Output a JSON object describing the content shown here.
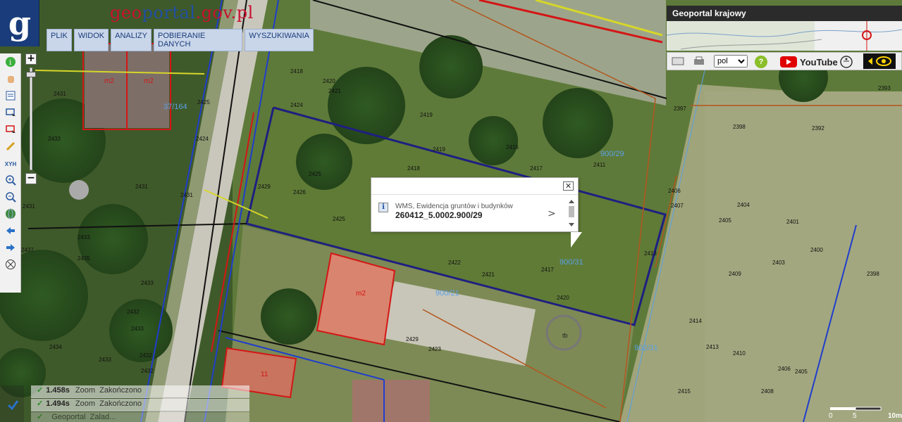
{
  "app": {
    "brand_part1": "geo",
    "brand_part2": "portal",
    "brand_part3": ".gov.pl",
    "logo_letter": "g"
  },
  "menu": [
    "PLIK",
    "WIDOK",
    "ANALIZY",
    "POBIERANIE DANYCH",
    "WYSZUKIWANIA"
  ],
  "toolbar": {
    "zoom_in_label": "+",
    "zoom_out_label": "−",
    "xyh_label": "XYH",
    "icons": [
      "info-icon",
      "hand-icon",
      "layers-icon",
      "select-icon",
      "select-red-icon",
      "pencil-icon",
      "xyh-icon",
      "zoom-in-icon",
      "zoom-out-icon",
      "globe-icon",
      "back-arrow-icon",
      "forward-arrow-icon",
      "compass-icon"
    ]
  },
  "overview": {
    "title": "Geoportal krajowy"
  },
  "topbar": {
    "language": "pol",
    "youtube_label": "YouTube",
    "help_label": "?"
  },
  "popup": {
    "layer": "WMS, Ewidencja gruntów i budynków",
    "parcel_id": "260412_5.0002.900/29",
    "close_label": "✕",
    "next_label": ">"
  },
  "status": [
    {
      "time": "1.458s",
      "action": "Zoom",
      "state": "Zakończono"
    },
    {
      "time": "1.494s",
      "action": "Zoom",
      "state": "Zakończono"
    },
    {
      "time": "",
      "action": "Geoportal",
      "state": "Zalad..."
    }
  ],
  "scale": {
    "start": "0",
    "mid": "5",
    "end": "10m"
  },
  "map_labels": {
    "parcels": [
      "900/29",
      "900/31",
      "900/21",
      "902/31",
      "37/164"
    ],
    "numbers": [
      "2431",
      "2425",
      "2428",
      "2426",
      "2433",
      "2434",
      "2435",
      "2437",
      "2432",
      "2429",
      "2420",
      "2421",
      "2419",
      "2418",
      "2416",
      "2417",
      "2411",
      "2404",
      "2401",
      "2400",
      "2403",
      "2409",
      "2414",
      "2413",
      "2410",
      "2406",
      "2405",
      "2408",
      "2398",
      "2392",
      "2393",
      "2397",
      "2415",
      "2423",
      "2422",
      "2424"
    ],
    "buildings": [
      "m2",
      "m2",
      "m2",
      "11",
      "tb"
    ]
  },
  "colors": {
    "parcel_line": "#1f1f80",
    "building_line": "#d41616",
    "utility_line": "#1f3ecc",
    "orange_line": "#b4561e",
    "label_blue": "#5aa0e6"
  }
}
